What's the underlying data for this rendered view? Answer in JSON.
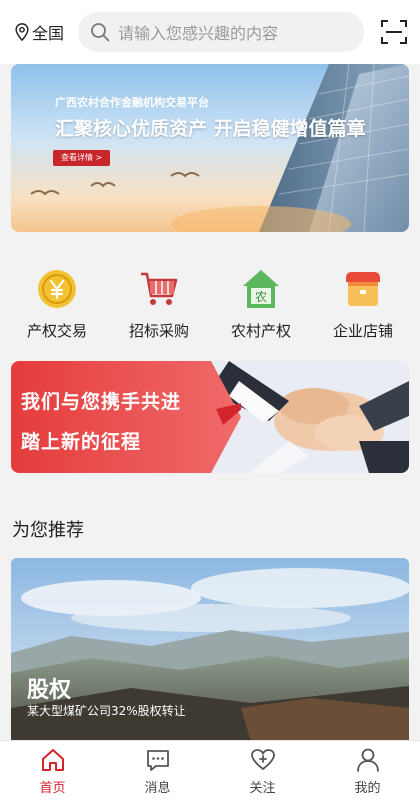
{
  "header": {
    "location": "全国",
    "search_placeholder": "请输入您感兴趣的内容"
  },
  "banner": {
    "subtitle": "广西农村合作金融机构交易平台",
    "title": "汇聚核心优质资产  开启稳健增值篇章",
    "button": "查看详情 >"
  },
  "categories": [
    {
      "label": "产权交易",
      "icon": "yuan-coin-icon"
    },
    {
      "label": "招标采购",
      "icon": "shopping-cart-icon"
    },
    {
      "label": "农村产权",
      "icon": "rural-house-icon"
    },
    {
      "label": "企业店铺",
      "icon": "shop-icon"
    }
  ],
  "promo": {
    "line1": "我们与您携手共进",
    "line2": "踏上新的征程"
  },
  "section": {
    "title": "为您推荐"
  },
  "recommend": {
    "title": "股权",
    "description": "某大型煤矿公司32%股权转让"
  },
  "nav": [
    {
      "label": "首页",
      "icon": "home-icon",
      "active": true
    },
    {
      "label": "消息",
      "icon": "message-icon",
      "active": false
    },
    {
      "label": "关注",
      "icon": "heart-plus-icon",
      "active": false
    },
    {
      "label": "我的",
      "icon": "user-icon",
      "active": false
    }
  ],
  "colors": {
    "accent": "#d6232b",
    "background": "#f2f2f2"
  }
}
